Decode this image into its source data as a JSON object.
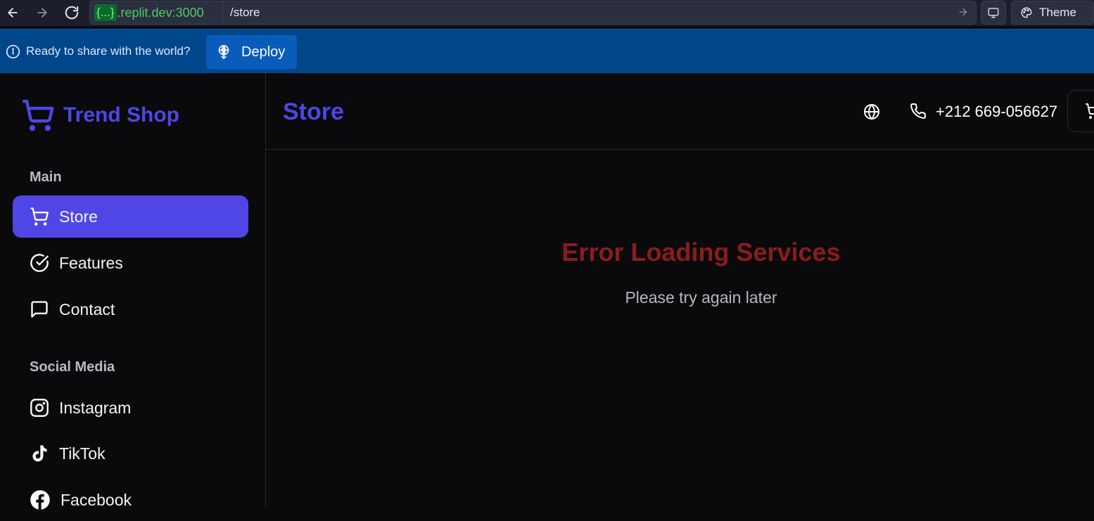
{
  "browser": {
    "url_prefix": "{...}",
    "url_host": ".replit.dev:3000",
    "url_path": "/store",
    "theme_label": "Theme"
  },
  "banner": {
    "text": "Ready to share with the world?",
    "deploy_label": "Deploy"
  },
  "sidebar": {
    "brand": "Trend Shop",
    "sections": [
      {
        "title": "Main",
        "items": [
          {
            "label": "Store",
            "icon": "cart-icon",
            "active": true
          },
          {
            "label": "Features",
            "icon": "check-circle-icon",
            "active": false
          },
          {
            "label": "Contact",
            "icon": "message-square-icon",
            "active": false
          }
        ]
      },
      {
        "title": "Social Media",
        "items": [
          {
            "label": "Instagram",
            "icon": "instagram-icon"
          },
          {
            "label": "TikTok",
            "icon": "tiktok-icon"
          },
          {
            "label": "Facebook",
            "icon": "facebook-icon"
          }
        ]
      }
    ]
  },
  "header": {
    "title": "Store",
    "phone": "+212 669-056627"
  },
  "main": {
    "error_title": "Error Loading Services",
    "error_message": "Please try again later"
  },
  "colors": {
    "accent": "#4f46e5",
    "error": "#8b1c1c",
    "banner": "#00468a"
  }
}
